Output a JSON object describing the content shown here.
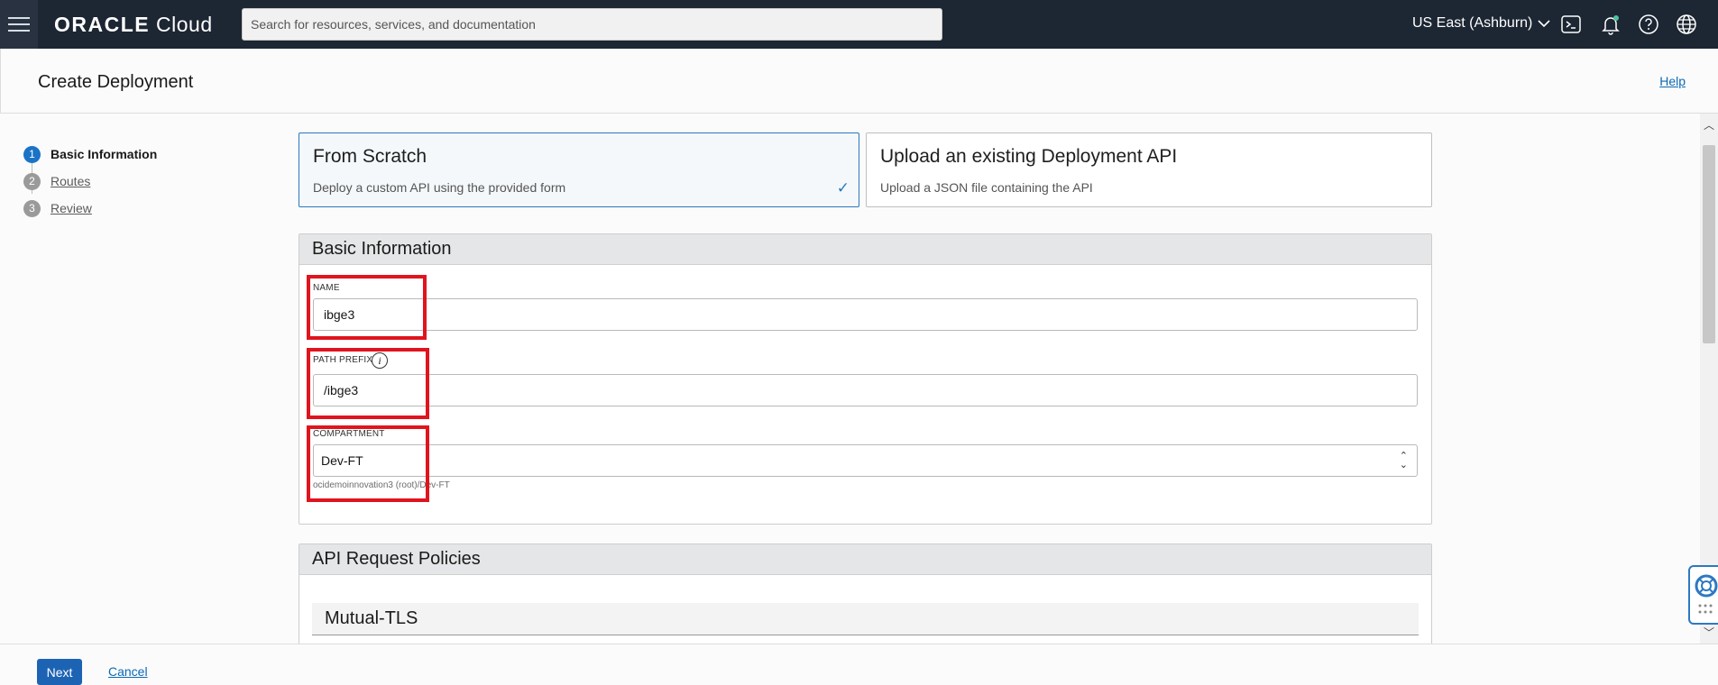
{
  "topbar": {
    "brand_bold": "ORACLE",
    "brand_light": "Cloud",
    "search_placeholder": "Search for resources, services, and documentation",
    "region": "US East (Ashburn)"
  },
  "header": {
    "title": "Create Deployment",
    "help": "Help"
  },
  "steps": [
    {
      "num": "1",
      "label": "Basic Information",
      "active": true
    },
    {
      "num": "2",
      "label": "Routes",
      "active": false
    },
    {
      "num": "3",
      "label": "Review",
      "active": false
    }
  ],
  "options": {
    "scratch": {
      "title": "From Scratch",
      "desc": "Deploy a custom API using the provided form",
      "selected": true
    },
    "upload": {
      "title": "Upload an existing Deployment API",
      "desc": "Upload a JSON file containing the API",
      "selected": false
    }
  },
  "basic_info": {
    "heading": "Basic Information",
    "name_label": "NAME",
    "name_value": "ibge3",
    "path_label": "PATH PREFIX",
    "path_value": "/ibge3",
    "compartment_label": "COMPARTMENT",
    "compartment_value": "Dev-FT",
    "compartment_path": "ocidemoinnovation3 (root)/Dev-FT"
  },
  "policies": {
    "heading": "API Request Policies",
    "mutual_tls": "Mutual-TLS"
  },
  "footer": {
    "next": "Next",
    "cancel": "Cancel"
  },
  "colors": {
    "topbar": "#1d2633",
    "accent": "#1d63b4",
    "highlight": "#e0141e"
  },
  "icons": [
    "menu-icon",
    "cloud-shell-icon",
    "bell-icon",
    "help-circle-icon",
    "globe-icon",
    "info-icon",
    "checkmark-icon",
    "lifebuoy-icon"
  ]
}
